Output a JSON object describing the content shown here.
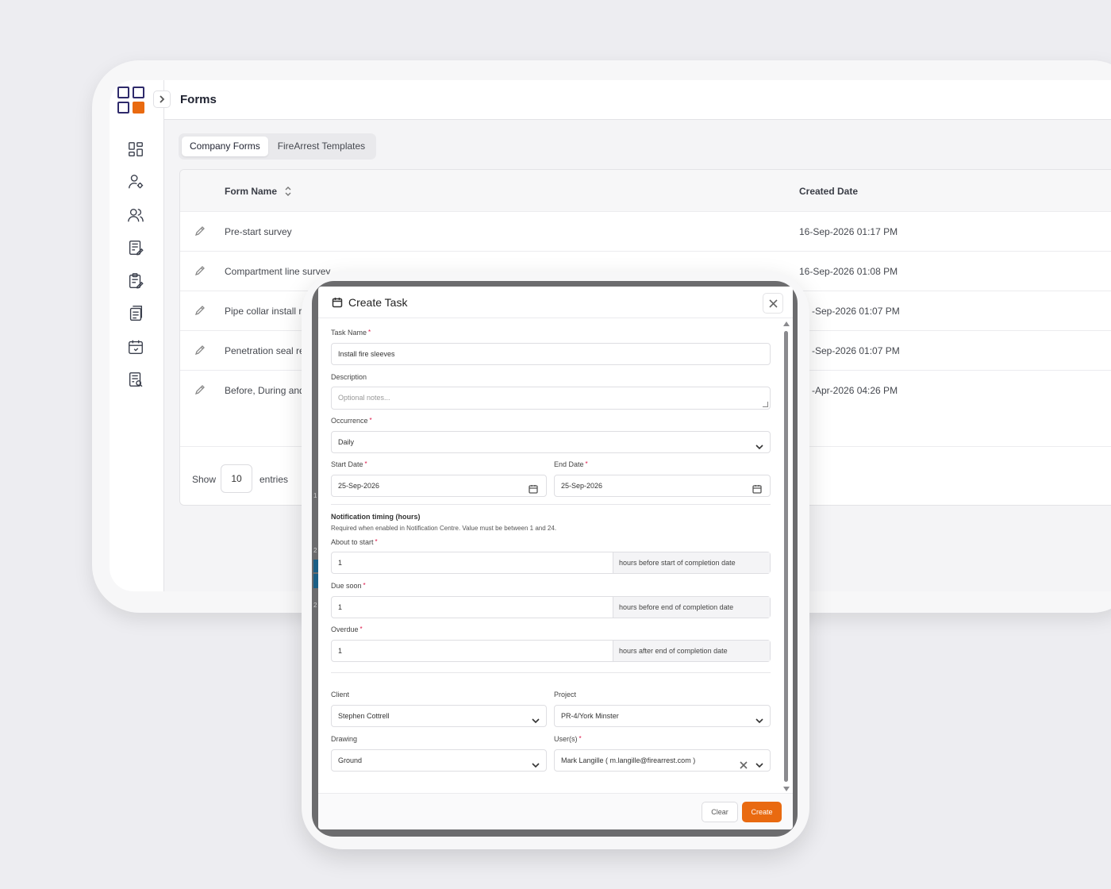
{
  "app": {
    "page_title": "Forms"
  },
  "sidebar": {
    "icons": [
      "dashboard-icon",
      "user-settings-icon",
      "users-icon",
      "forms-edit-icon",
      "clipboard-edit-icon",
      "documents-icon",
      "calendar-icon",
      "report-search-icon"
    ]
  },
  "tabs": [
    {
      "label": "Company Forms",
      "active": true
    },
    {
      "label": "FireArrest Templates",
      "active": false
    }
  ],
  "table": {
    "columns": {
      "name": "Form Name",
      "date": "Created Date"
    },
    "rows": [
      {
        "name": "Pre-start survey",
        "date": "16-Sep-2026 01:17 PM"
      },
      {
        "name": "Compartment line survey",
        "date": "16-Sep-2026 01:08 PM"
      },
      {
        "name": "Pipe collar install re",
        "date": "-Sep-2026 01:07 PM"
      },
      {
        "name": "Penetration seal rec",
        "date": "-Sep-2026 01:07 PM"
      },
      {
        "name": "Before, During and",
        "date": "-Apr-2026 04:26 PM"
      }
    ],
    "pager": {
      "show": "Show",
      "entries_value": "10",
      "entries": "entries"
    }
  },
  "background_fragments": {
    "c1": "1",
    "c2": "2",
    "c3": "2"
  },
  "modal": {
    "title": "Create Task",
    "task_name": {
      "label": "Task Name",
      "value": "Install fire sleeves"
    },
    "description": {
      "label": "Description",
      "placeholder": "Optional notes..."
    },
    "occurrence": {
      "label": "Occurrence",
      "value": "Daily"
    },
    "start_date": {
      "label": "Start Date",
      "value": "25-Sep-2026"
    },
    "end_date": {
      "label": "End Date",
      "value": "25-Sep-2026"
    },
    "notification": {
      "title": "Notification timing (hours)",
      "help": "Required when enabled in Notification Centre. Value must be between 1 and 24.",
      "about_to_start": {
        "label": "About to start",
        "value": "1",
        "suffix": "hours before start of completion date"
      },
      "due_soon": {
        "label": "Due soon",
        "value": "1",
        "suffix": "hours before end of completion date"
      },
      "overdue": {
        "label": "Overdue",
        "value": "1",
        "suffix": "hours after end of completion date"
      }
    },
    "client": {
      "label": "Client",
      "value": "Stephen Cottrell"
    },
    "project": {
      "label": "Project",
      "value": "PR-4/York Minster"
    },
    "drawing": {
      "label": "Drawing",
      "value": "Ground"
    },
    "users": {
      "label": "User(s)",
      "value": "Mark Langille ( m.langille@firearrest.com )"
    },
    "required_mark": "*",
    "buttons": {
      "clear": "Clear",
      "create": "Create"
    }
  },
  "colors": {
    "accent": "#e96a10",
    "logo_dark": "#2e2a6b"
  }
}
